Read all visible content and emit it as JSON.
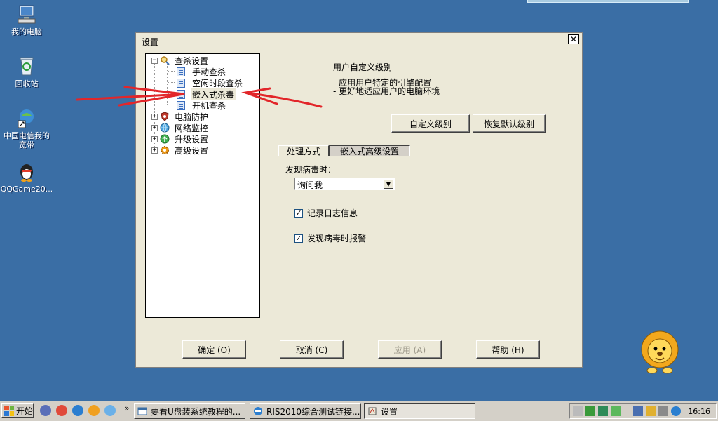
{
  "desktop": {
    "icons": [
      {
        "label": "我的电脑",
        "icon": "computer-icon"
      },
      {
        "label": "回收站",
        "icon": "recycle-bin-icon"
      },
      {
        "label": "中国电信我的宽带",
        "icon": "broadband-icon"
      },
      {
        "label": "QQGame20...",
        "icon": "qq-penguin-icon"
      }
    ]
  },
  "dialog": {
    "title": "设置",
    "close_icon": "close-icon",
    "tree": [
      {
        "label": "查杀设置",
        "expander": "⊟",
        "icon": "magnifier-icon"
      },
      {
        "label": "手动查杀",
        "icon": "page-icon"
      },
      {
        "label": "空闲时段查杀",
        "icon": "page-icon"
      },
      {
        "label": "嵌入式杀毒",
        "icon": "page-icon",
        "selected": true
      },
      {
        "label": "开机查杀",
        "icon": "page-icon"
      },
      {
        "label": "电脑防护",
        "expander": "⊞",
        "icon": "shield-icon"
      },
      {
        "label": "网络监控",
        "expander": "⊞",
        "icon": "globe-icon"
      },
      {
        "label": "升级设置",
        "expander": "⊞",
        "icon": "update-icon"
      },
      {
        "label": "高级设置",
        "expander": "⊞",
        "icon": "gear-icon"
      }
    ],
    "level": {
      "title": "用户自定义级别",
      "lines": [
        "-  应用用户特定的引擎配置",
        "-  更好地适应用户的电脑环境"
      ],
      "custom_button": "自定义级别",
      "restore_button": "恢复默认级别"
    },
    "tabs": [
      "处理方式",
      "嵌入式高级设置"
    ],
    "on_virus_label": "发现病毒时：",
    "action_select": "询问我",
    "checkboxes": [
      {
        "label": "记录日志信息",
        "checked": true
      },
      {
        "label": "发现病毒时报警",
        "checked": true
      }
    ],
    "buttons": {
      "ok": "确定 (O)",
      "cancel": "取消 (C)",
      "apply": "应用 (A)",
      "help": "帮助 (H)"
    }
  },
  "taskbar": {
    "start": "开始",
    "more": "»",
    "tasks": [
      {
        "label": "要看U盘装系统教程的...",
        "icon": "window-icon"
      },
      {
        "label": "RIS2010综合测试链接...",
        "icon": "browser-icon"
      },
      {
        "label": "设置",
        "icon": "settings-icon",
        "active": true
      }
    ],
    "clock": "16:16"
  },
  "colors": {
    "desktop": "#3a6ea5",
    "dialog": "#ece9d8",
    "arrow": "#e2262a"
  }
}
